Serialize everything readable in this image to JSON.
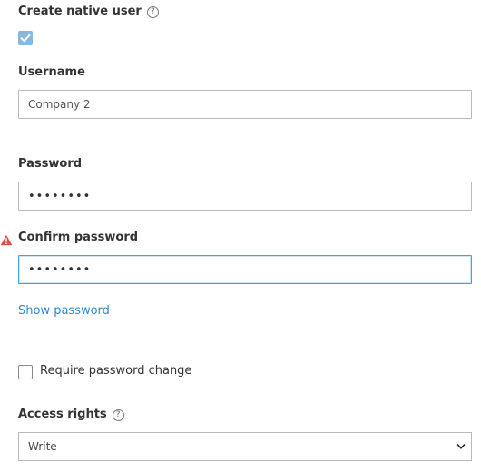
{
  "native_user": {
    "label": "Create native user",
    "help_icon": "?",
    "checked": true
  },
  "username": {
    "label": "Username",
    "value": "Company 2"
  },
  "password": {
    "label": "Password",
    "value": "••••••••"
  },
  "confirm_password": {
    "label": "Confirm password",
    "value": "••••••••",
    "warning_icon": "warning-icon"
  },
  "show_password": {
    "label": "Show password"
  },
  "require_change": {
    "label": "Require password change",
    "checked": false
  },
  "access_rights": {
    "label": "Access rights",
    "help_icon": "?",
    "selected": "Write"
  },
  "colors": {
    "link": "#2a8ccf",
    "focus_border": "#43a4dc",
    "checkbox_fill": "#86b8e0",
    "warning": "#d9534f"
  }
}
